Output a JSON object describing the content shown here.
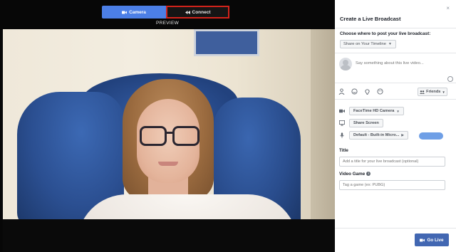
{
  "toolbar": {
    "camera_label": "Camera",
    "connect_label": "Connect",
    "camera_icon": "video-camera-icon",
    "connect_icon": "rewind-icon",
    "connect_highlight_color": "#d3231b",
    "camera_color": "#4c7fe6"
  },
  "preview": {
    "label": "PREVIEW"
  },
  "panel": {
    "close_symbol": "×",
    "title": "Create a Live Broadcast",
    "choose_label": "Choose where to post your live broadcast:",
    "share_target": "Share on Your Timeline",
    "compose_placeholder": "Say something about this live video...",
    "audience": "Friends",
    "camera_source": "FaceTime HD Camera",
    "share_screen_label": "Share Screen",
    "microphone_source": "Default - Built-in Micro...",
    "title_label": "Title",
    "title_placeholder": "Add a title for your live broadcast (optional)",
    "video_game_label": "Video Game",
    "video_game_placeholder": "Tag a game (ex: PUBG)",
    "go_live_label": "Go Live",
    "accent_color": "#4267b2"
  }
}
